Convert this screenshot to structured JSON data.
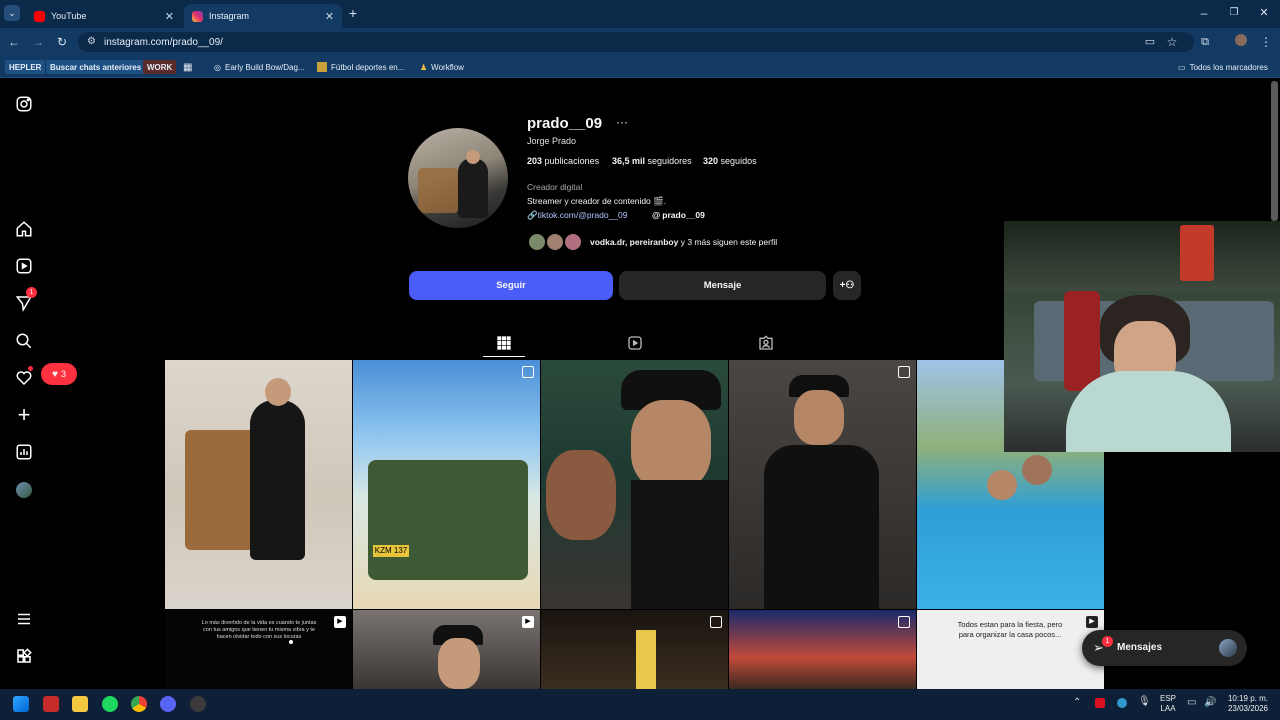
{
  "browser": {
    "tabs": [
      {
        "label": "YouTube",
        "active": false
      },
      {
        "label": "Instagram",
        "active": true
      }
    ],
    "url": "instagram.com/prado__09/",
    "bookmarks": [
      "HEPLER",
      "Buscar chats anteriores",
      "WORK",
      "Early Build Bow/Dag...",
      "Fútbol deportes en...",
      "Workflow"
    ],
    "bookmarks_right": "Todos los marcadores"
  },
  "profile": {
    "username": "prado__09",
    "full_name": "Jorge Prado",
    "posts_count": "203",
    "posts_label": "publicaciones",
    "followers_count": "36,5 mil",
    "followers_label": "seguidores",
    "following_count": "320",
    "following_label": "seguidos",
    "category": "Creador digital",
    "bio": "Streamer y creador de contenido 🎬.",
    "link": "tiktok.com/@prado__09",
    "threads": "prado__09",
    "followed_by_names": "vodka.dr, pereiranboy",
    "followed_by_rest": "y 3 más siguen este perfil",
    "follow_button": "Seguir",
    "message_button": "Mensaje"
  },
  "nav": {
    "notifications_badge": "1",
    "likes_badge": "3"
  },
  "grid": {
    "captions": [
      "Lo más divertido de la vida es cuando te juntas con tus amigos que tienen tu misma vibra y te hacen olvidar todo con sus locuras",
      "Todos estan para la fiesta, pero para organizar la casa pocos..."
    ]
  },
  "messages": {
    "label": "Mensajes",
    "badge": "1"
  },
  "taskbar": {
    "lang": "ESP",
    "lang2": "LAA",
    "time": "10:19 p. m.",
    "date": "23/03/2026"
  },
  "colors": {
    "accent": "#4a5df9",
    "badge": "#ff3040",
    "secondary_btn": "#262626"
  }
}
